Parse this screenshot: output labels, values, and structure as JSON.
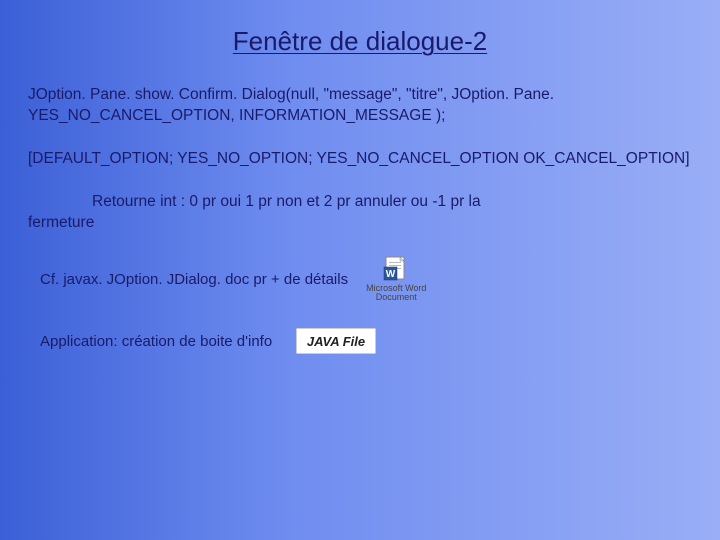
{
  "title": "Fenêtre de dialogue-2",
  "code_block": "JOption. Pane. show. Confirm. Dialog(null, \"message\", \"titre\", JOption. Pane. YES_NO_CANCEL_OPTION, INFORMATION_MESSAGE );",
  "options_block": "[DEFAULT_OPTION; YES_NO_OPTION; YES_NO_CANCEL_OPTION OK_CANCEL_OPTION]",
  "return_text_prefix": "Retourne int : 0 pr oui 1 pr non et 2 pr annuler ou -1 pr la",
  "return_text_line2": "fermeture",
  "cf_text": "Cf. javax. JOption. JDialog. doc pr + de détails",
  "word_caption_line1": "Microsoft Word",
  "word_caption_line2": "Document",
  "app_text": "Application: création de boite d'info",
  "java_label": "JAVA File",
  "icons": {
    "word": "word-doc-icon",
    "java": "java-file-icon"
  }
}
